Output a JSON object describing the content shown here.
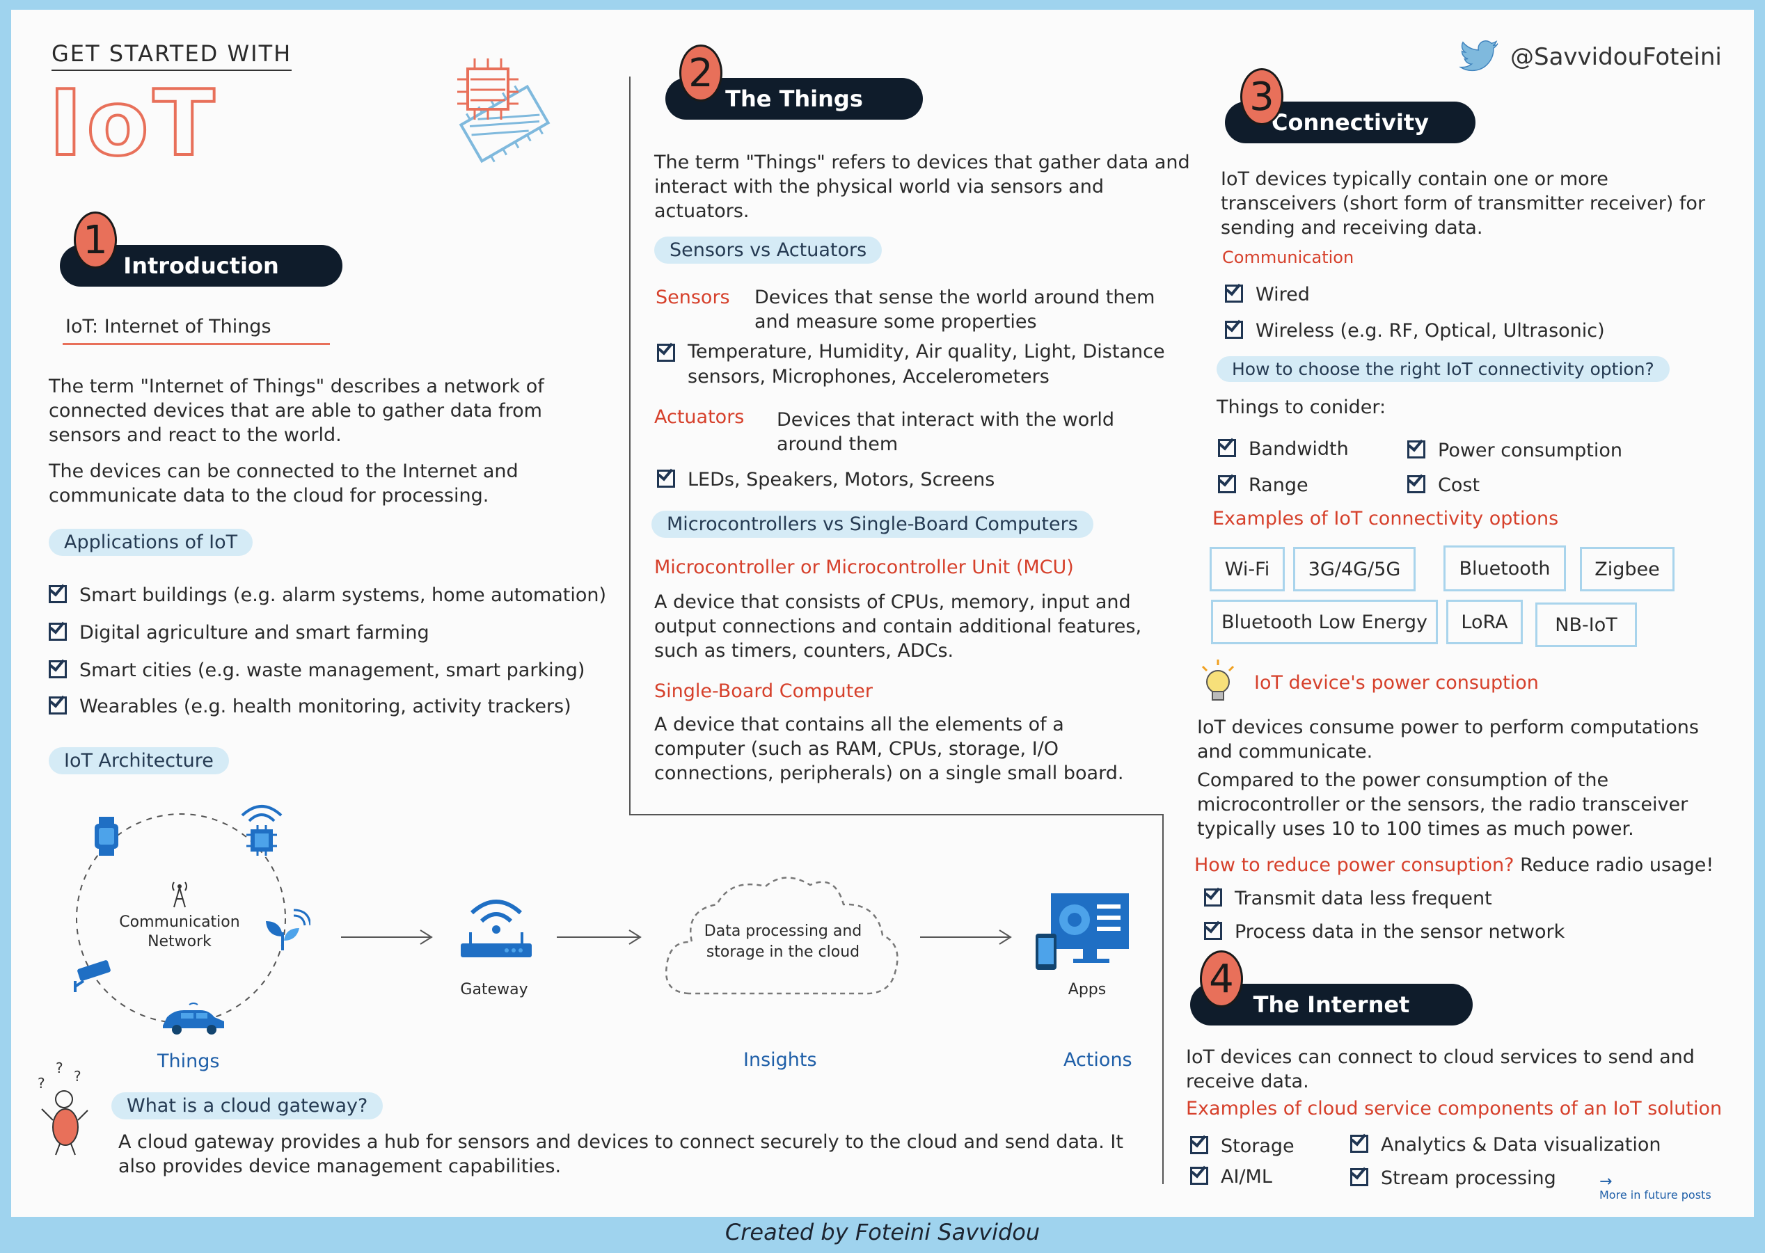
{
  "header": {
    "get_started": "GET STARTED WITH",
    "iot_logo": "IoT",
    "handle": "@SavvidouFoteini",
    "footer": "Created by Foteini Savvidou"
  },
  "intro": {
    "number": "1",
    "title": "Introduction",
    "subtitle": "IoT: Internet of Things",
    "para1": "The term \"Internet of Things\" describes a network of connected devices that are able to gather data from sensors and react to the world.",
    "para2": "The devices can be connected to the Internet and communicate data to the cloud for processing.",
    "applications_title": "Applications of IoT",
    "applications": [
      "Smart buildings (e.g. alarm systems, home automation)",
      "Digital agriculture and smart farming",
      "Smart cities (e.g. waste management, smart parking)",
      "Wearables (e.g. health monitoring, activity trackers)"
    ],
    "architecture_title": "IoT Architecture"
  },
  "architecture": {
    "network_label": "Communication Network",
    "gateway_label": "Gateway",
    "cloud_label": "Data processing and storage in the cloud",
    "apps_label": "Apps",
    "things": "Things",
    "insights": "Insights",
    "actions": "Actions"
  },
  "gateway_note": {
    "question": "What is a cloud gateway?",
    "answer": "A cloud gateway provides a hub for sensors and devices to connect securely to the cloud and send data. It also provides device management capabilities."
  },
  "things": {
    "number": "2",
    "title": "The Things",
    "para": "The term \"Things\" refers to devices that gather data and interact with the physical world via sensors and actuators.",
    "sva_title": "Sensors vs Actuators",
    "sensors_label": "Sensors",
    "sensors_desc": "Devices that sense the world around them and measure some properties",
    "sensors_examples": "Temperature, Humidity, Air quality, Light, Distance sensors, Microphones, Accelerometers",
    "actuators_label": "Actuators",
    "actuators_desc": "Devices that interact with the world around them",
    "actuators_examples": "LEDs, Speakers, Motors, Screens",
    "mvs_title": "Microcontrollers vs Single-Board Computers",
    "mcu_title": "Microcontroller or Microcontroller Unit (MCU)",
    "mcu_desc": "A device that consists of CPUs, memory, input and output connections and contain additional features, such as timers, counters, ADCs.",
    "sbc_title": "Single-Board Computer",
    "sbc_desc": "A device that contains all the elements of a computer (such as RAM, CPUs, storage, I/O connections, peripherals) on a single small board."
  },
  "connectivity": {
    "number": "3",
    "title": "Connectivity",
    "para": "IoT devices typically contain one or more transceivers (short form of transmitter receiver) for sending and receiving data.",
    "communication_title": "Communication",
    "communication": [
      "Wired",
      "Wireless (e.g. RF, Optical, Ultrasonic)"
    ],
    "choose_title": "How to choose the right IoT connectivity option?",
    "consider": "Things to conider:",
    "considerations": [
      "Bandwidth",
      "Range",
      "Power consumption",
      "Cost"
    ],
    "examples_title": "Examples of IoT connectivity options",
    "options": [
      "Wi-Fi",
      "3G/4G/5G",
      "Bluetooth",
      "Zigbee",
      "Bluetooth Low Energy",
      "LoRA",
      "NB-IoT"
    ],
    "power_title": "IoT device's power consuption",
    "power_para1": "IoT devices consume power to perform computations and communicate.",
    "power_para2": "Compared to the power consumption of the microcontroller or the sensors, the radio transceiver typically uses 10 to 100 times as much power.",
    "reduce_q": "How to reduce power consuption?",
    "reduce_a": "Reduce radio usage!",
    "reduce_items": [
      "Transmit data less frequent",
      "Process data in the sensor network"
    ]
  },
  "internet": {
    "number": "4",
    "title": "The Internet",
    "para": "IoT devices can connect to cloud services to send and receive data.",
    "examples_title": "Examples of cloud service components of an IoT solution",
    "components": [
      "Storage",
      "AI/ML",
      "Analytics & Data visualization",
      "Stream processing"
    ],
    "more": "More in future posts"
  },
  "colors": {
    "accent_red": "#d6402b",
    "navy": "#0f1c2b",
    "pill_blue": "#d5ebf6",
    "icon_blue": "#1f6fc4"
  }
}
